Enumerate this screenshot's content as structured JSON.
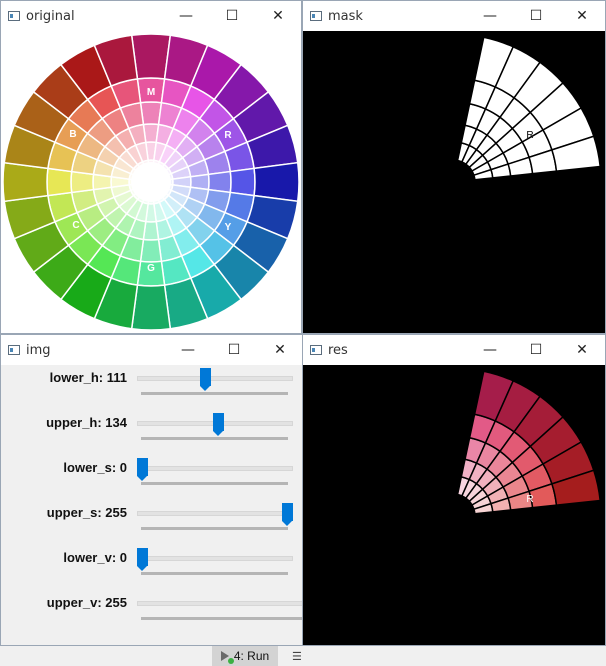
{
  "windows": {
    "original": {
      "title": "original"
    },
    "mask": {
      "title": "mask"
    },
    "img": {
      "title": "img"
    },
    "res": {
      "title": "res"
    }
  },
  "controls": {
    "minimize": "—",
    "maximize": "☐",
    "close": "✕"
  },
  "trackbars": [
    {
      "label": "lower_h: 111",
      "value": 111,
      "max": 255,
      "show_thumb": true
    },
    {
      "label": "upper_h: 134",
      "value": 134,
      "max": 255,
      "show_thumb": true
    },
    {
      "label": "lower_s: 0",
      "value": 0,
      "max": 255,
      "show_thumb": true
    },
    {
      "label": "upper_s: 255",
      "value": 255,
      "max": 255,
      "show_thumb": true
    },
    {
      "label": "lower_v: 0",
      "value": 0,
      "max": 255,
      "show_thumb": true
    },
    {
      "label": "upper_v: 255",
      "value": 255,
      "max": 255,
      "show_thumb": false
    }
  ],
  "wheel_labels": {
    "m": "M",
    "r": "R",
    "y": "Y",
    "g": "G",
    "c": "C",
    "b": "B"
  },
  "run_button": {
    "label": "4: Run"
  },
  "colors": {
    "thumb": "#0078d7",
    "window_border": "#9aa6b5"
  }
}
